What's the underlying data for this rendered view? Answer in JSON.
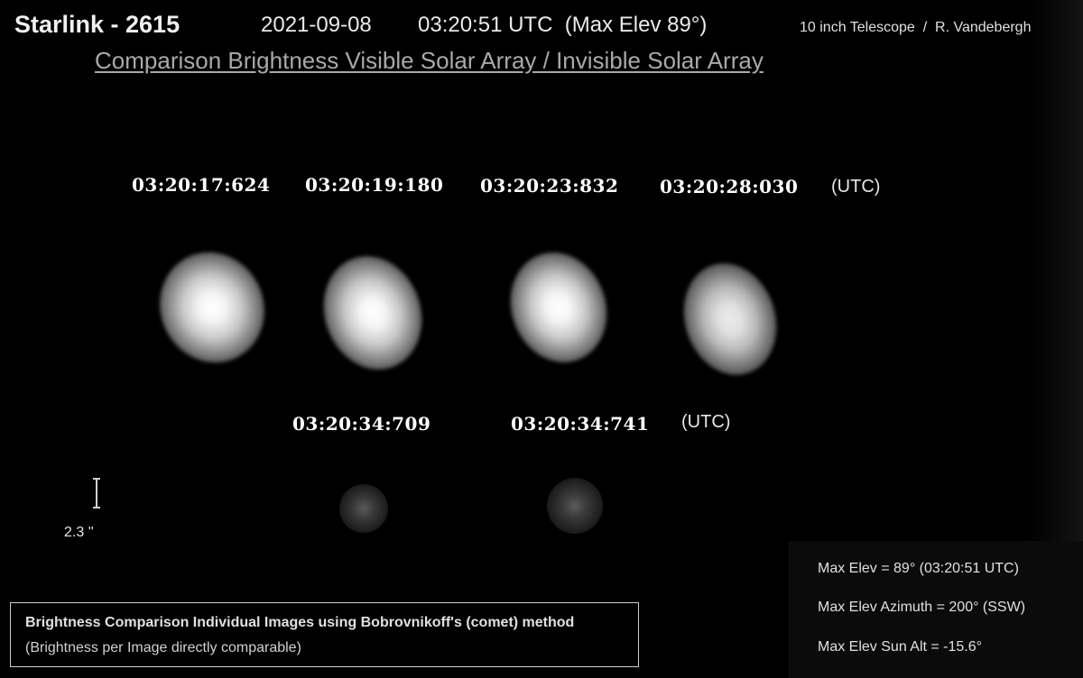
{
  "header": {
    "title": "Starlink - 2615",
    "date": "2021-09-08",
    "time_line": "03:20:51 UTC  (Max Elev 89°)",
    "credit": "10 inch Telescope  /  R. Vandebergh",
    "subtitle": "Comparison Brightness Visible Solar Array / Invisible Solar Array"
  },
  "row1": {
    "timestamps": [
      "03:20:17:624",
      "03:20:19:180",
      "03:20:23:832",
      "03:20:28:030"
    ],
    "unit": "(UTC)"
  },
  "row2": {
    "timestamps": [
      "03:20:34:709",
      "03:20:34:741"
    ],
    "unit": "(UTC)"
  },
  "scale": {
    "label": "2.3 ''"
  },
  "note": {
    "line1": "Brightness Comparison Individual Images using Bobrovnikoff's (comet) method",
    "line2": "(Brightness per Image directly comparable)"
  },
  "stats": [
    "Max Elev = 89° (03:20:51 UTC)",
    "Max Elev Azimuth = 200° (SSW)",
    "Max Elev Sun Alt = -15.6°"
  ],
  "icons": {
    "satellite_images": "blurred-satellite-image",
    "scale_bar": "scale-bar-icon"
  }
}
